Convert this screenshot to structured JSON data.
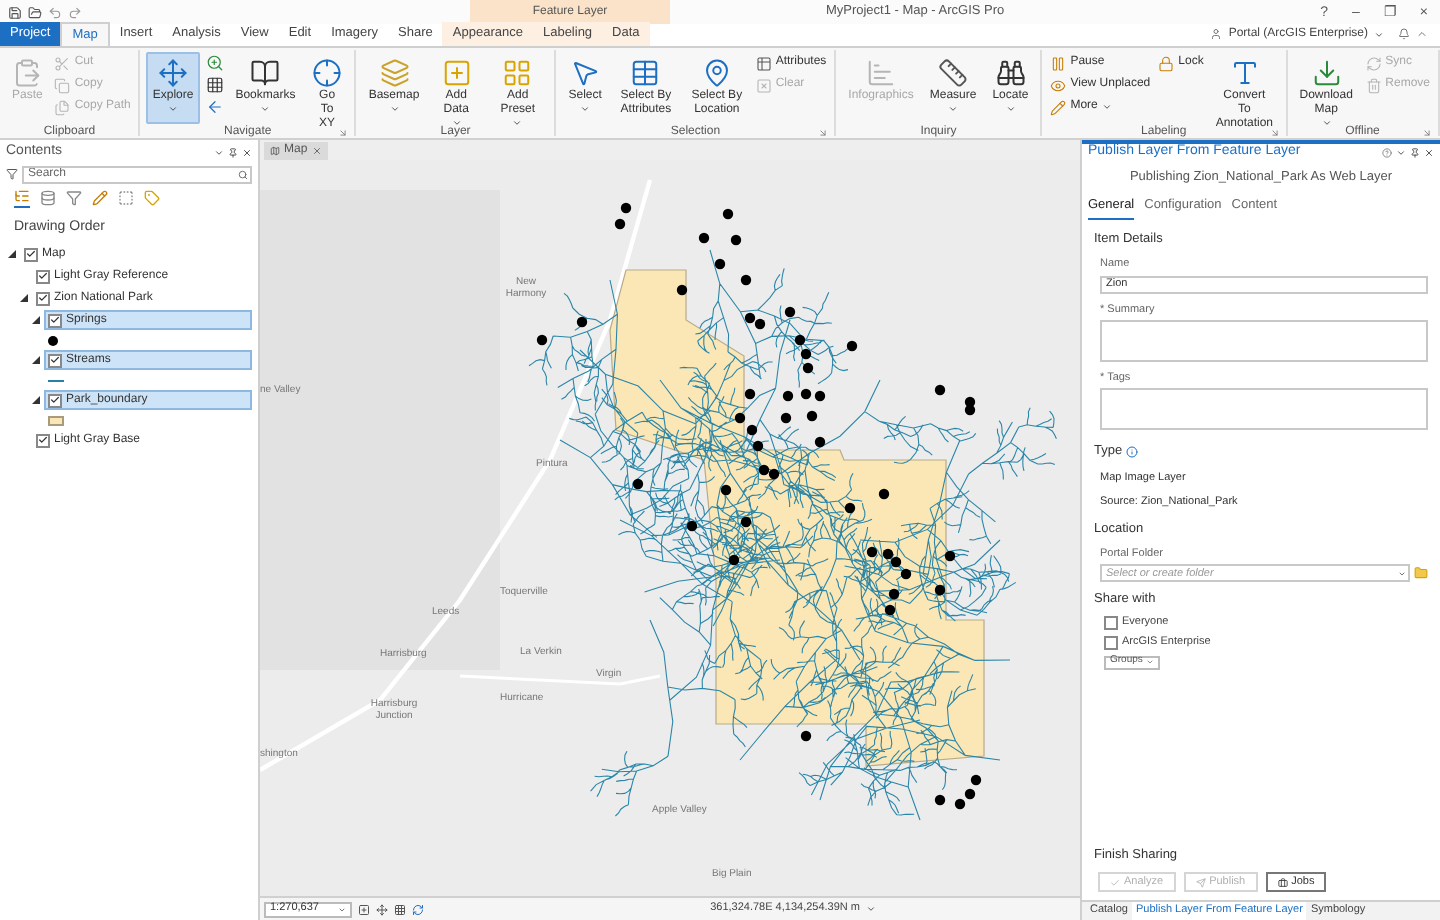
{
  "window": {
    "title": "MyProject1 - Map - ArcGIS Pro",
    "context_label": "Feature Layer",
    "controls": [
      "?",
      "–",
      "❐",
      "×"
    ]
  },
  "tabs": [
    {
      "label": "Project",
      "kind": "file",
      "selected": false
    },
    {
      "label": "Map",
      "kind": "normal",
      "selected": true
    },
    {
      "label": "Insert",
      "kind": "normal",
      "selected": false
    },
    {
      "label": "Analysis",
      "kind": "normal",
      "selected": false
    },
    {
      "label": "View",
      "kind": "normal",
      "selected": false
    },
    {
      "label": "Edit",
      "kind": "normal",
      "selected": false
    },
    {
      "label": "Imagery",
      "kind": "normal",
      "selected": false
    },
    {
      "label": "Share",
      "kind": "normal",
      "selected": false
    },
    {
      "label": "Appearance",
      "kind": "contextual",
      "selected": false
    },
    {
      "label": "Labeling",
      "kind": "contextual",
      "selected": false
    },
    {
      "label": "Data",
      "kind": "contextual",
      "selected": false
    }
  ],
  "portal": {
    "label": "Portal (ArcGIS Enterprise)"
  },
  "ribbon": {
    "groups": [
      {
        "label": "Clipboard",
        "launcher": false,
        "items": [
          {
            "kind": "large",
            "label": "Paste",
            "disabled": true,
            "active": false,
            "dropdown": false
          },
          {
            "kind": "small",
            "label": "Cut",
            "disabled": true,
            "active": false,
            "dropdown": false
          },
          {
            "kind": "small",
            "label": "Copy",
            "disabled": true,
            "active": false,
            "dropdown": false
          },
          {
            "kind": "small",
            "label": "Copy Path",
            "disabled": true,
            "active": false,
            "dropdown": false
          }
        ]
      },
      {
        "label": "Navigate",
        "launcher": true,
        "items": [
          {
            "kind": "large",
            "label": "Explore",
            "disabled": false,
            "active": true,
            "dropdown": true
          },
          {
            "kind": "icon",
            "disabled": false,
            "active": false,
            "dropdown": false
          },
          {
            "kind": "icon",
            "disabled": false,
            "active": false,
            "dropdown": false
          },
          {
            "kind": "icon",
            "disabled": false,
            "active": false,
            "dropdown": false
          },
          {
            "kind": "large",
            "label": "Bookmarks",
            "disabled": false,
            "active": false,
            "dropdown": true
          },
          {
            "kind": "large",
            "label": "Go To XY",
            "disabled": false,
            "active": false,
            "dropdown": false
          }
        ]
      },
      {
        "label": "Layer",
        "launcher": false,
        "items": [
          {
            "kind": "large",
            "label": "Basemap",
            "disabled": false,
            "active": false,
            "dropdown": true
          },
          {
            "kind": "large",
            "label": "Add Data",
            "disabled": false,
            "active": false,
            "dropdown": true
          },
          {
            "kind": "large",
            "label": "Add Preset",
            "disabled": false,
            "active": false,
            "dropdown": true
          }
        ]
      },
      {
        "label": "Selection",
        "launcher": true,
        "items": [
          {
            "kind": "large",
            "label": "Select",
            "disabled": false,
            "active": false,
            "dropdown": true
          },
          {
            "kind": "large",
            "label": "Select By Attributes",
            "disabled": false,
            "active": false,
            "dropdown": false
          },
          {
            "kind": "large",
            "label": "Select By Location",
            "disabled": false,
            "active": false,
            "dropdown": false
          },
          {
            "kind": "small",
            "label": "Attributes",
            "disabled": false,
            "active": false,
            "dropdown": false
          },
          {
            "kind": "small",
            "label": "Clear",
            "disabled": true,
            "active": false,
            "dropdown": false
          }
        ]
      },
      {
        "label": "Inquiry",
        "launcher": false,
        "items": [
          {
            "kind": "large",
            "label": "Infographics",
            "disabled": true,
            "active": false,
            "dropdown": false
          },
          {
            "kind": "large",
            "label": "Measure",
            "disabled": false,
            "active": false,
            "dropdown": true
          },
          {
            "kind": "large",
            "label": "Locate",
            "disabled": false,
            "active": false,
            "dropdown": true
          }
        ]
      },
      {
        "label": "Labeling",
        "launcher": true,
        "items": [
          {
            "kind": "small",
            "label": "Pause",
            "disabled": false,
            "active": false,
            "dropdown": false
          },
          {
            "kind": "small",
            "label": "View Unplaced",
            "disabled": false,
            "active": false,
            "dropdown": false
          },
          {
            "kind": "small",
            "label": "More",
            "disabled": false,
            "active": false,
            "dropdown": true
          },
          {
            "kind": "small",
            "label": "Lock",
            "disabled": false,
            "active": false,
            "dropdown": false
          },
          {
            "kind": "large",
            "label": "Convert To Annotation",
            "disabled": false,
            "active": false,
            "dropdown": false
          }
        ]
      },
      {
        "label": "Offline",
        "launcher": true,
        "items": [
          {
            "kind": "large",
            "label": "Download Map",
            "disabled": false,
            "active": false,
            "dropdown": true
          },
          {
            "kind": "small",
            "label": "Sync",
            "disabled": true,
            "active": false,
            "dropdown": false
          },
          {
            "kind": "small",
            "label": "Remove",
            "disabled": true,
            "active": false,
            "dropdown": false
          }
        ]
      }
    ]
  },
  "contents": {
    "title": "Contents",
    "search": {
      "placeholder": "Search"
    },
    "heading": "Drawing Order",
    "tree": [
      {
        "label": "Map",
        "checked": true,
        "selected": false,
        "expanded": true,
        "children": [
          {
            "label": "Light Gray Reference",
            "checked": true,
            "selected": false
          },
          {
            "label": "Zion National Park",
            "checked": true,
            "selected": false,
            "expanded": true,
            "children": [
              {
                "label": "Springs",
                "checked": true,
                "selected": true,
                "expanded": true,
                "kind": "point"
              },
              {
                "label": "Streams",
                "checked": true,
                "selected": true,
                "expanded": true,
                "kind": "line"
              },
              {
                "label": "Park_boundary",
                "checked": true,
                "selected": true,
                "expanded": true,
                "kind": "polygon"
              }
            ]
          },
          {
            "label": "Light Gray Base",
            "checked": true,
            "selected": false
          }
        ]
      }
    ]
  },
  "map": {
    "tab": "Map",
    "places": [
      "New Harmony",
      "ne Valley",
      "Pintura",
      "Toquerville",
      "Leeds",
      "Harrisburg",
      "La Verkin",
      "Virgin",
      "Hurricane",
      "Harrisburg Junction",
      "shington",
      "Apple Valley",
      "Big Plain"
    ],
    "scale": "1:270,637",
    "coordinates": "361,324.78E 4,134,254.39N m"
  },
  "pane": {
    "title": "Publish Layer From Feature Layer",
    "subtitle": "Publishing Zion_National_Park As Web Layer",
    "tabs": [
      {
        "label": "General",
        "selected": true
      },
      {
        "label": "Configuration",
        "selected": false
      },
      {
        "label": "Content",
        "selected": false
      }
    ],
    "section": "Item Details",
    "fields": [
      {
        "label": "Name",
        "value": "Zion",
        "kind": "line"
      },
      {
        "label": "* Summary",
        "kind": "area"
      },
      {
        "label": "* Tags",
        "kind": "area"
      }
    ],
    "type_heading": "Type",
    "type_value": "Map Image Layer",
    "source": "Source: Zion_National_Park",
    "location_heading": "Location",
    "folder_label": "Portal Folder",
    "folder": {
      "placeholder": "Select or create folder"
    },
    "share_heading": "Share with",
    "share": [
      {
        "label": "Everyone",
        "checked": false
      },
      {
        "label": "ArcGIS Enterprise",
        "checked": false
      }
    ],
    "groups": "Groups",
    "finish_heading": "Finish Sharing",
    "buttons": [
      {
        "label": "Analyze",
        "disabled": true
      },
      {
        "label": "Publish",
        "disabled": true
      },
      {
        "label": "Jobs",
        "disabled": false
      }
    ],
    "bottom_tabs": [
      {
        "label": "Catalog",
        "selected": false
      },
      {
        "label": "Publish Layer From Feature Layer",
        "selected": true
      },
      {
        "label": "Symbology",
        "selected": false
      }
    ]
  }
}
